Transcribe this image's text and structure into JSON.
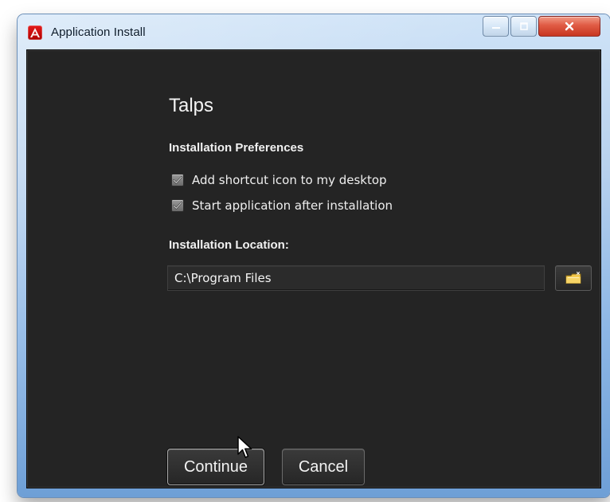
{
  "window": {
    "title": "Application Install"
  },
  "installer": {
    "app_name": "Talps",
    "preferences": {
      "heading": "Installation Preferences",
      "options": [
        {
          "label": "Add shortcut icon to my desktop",
          "checked": true
        },
        {
          "label": "Start application after installation",
          "checked": true
        }
      ]
    },
    "location": {
      "heading": "Installation Location:",
      "value": "C:\\Program Files"
    }
  },
  "buttons": {
    "continue": "Continue",
    "cancel": "Cancel"
  },
  "icons": {
    "app": "adobe-air-icon",
    "minimize": "minimize-icon",
    "maximize": "maximize-icon",
    "close": "close-icon",
    "folder": "folder-icon",
    "checkmark": "checkmark-icon",
    "cursor": "mouse-cursor-icon"
  },
  "colors": {
    "client_bg": "#242424",
    "text": "#f2f2f2",
    "close_button": "#e05b44",
    "folder": "#f2c64a"
  }
}
